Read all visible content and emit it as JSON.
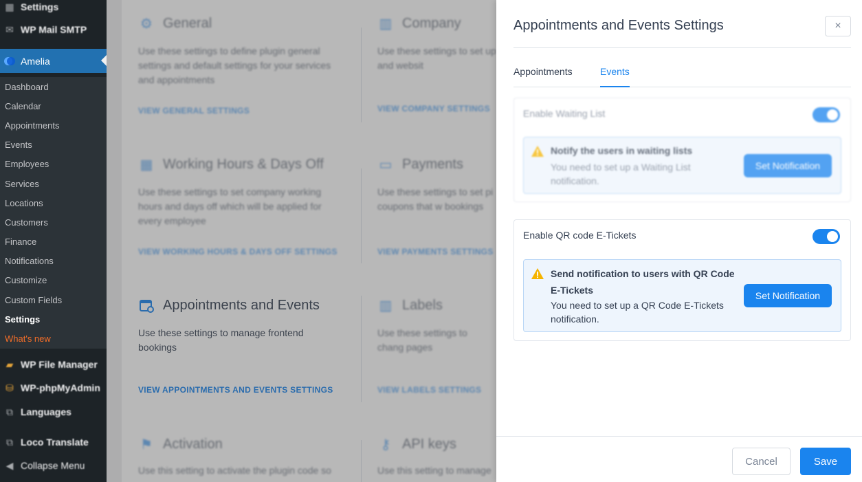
{
  "wp_menu": {
    "top_items": [
      {
        "label": "Settings",
        "icon": "settings-icon"
      },
      {
        "label": "WP Mail SMTP",
        "icon": "mail-icon"
      }
    ],
    "amelia": {
      "label": "Amelia",
      "icon": "amelia-logo-icon"
    },
    "submenu": [
      "Dashboard",
      "Calendar",
      "Appointments",
      "Events",
      "Employees",
      "Services",
      "Locations",
      "Customers",
      "Finance",
      "Notifications",
      "Customize",
      "Custom Fields",
      "Settings",
      "What's new"
    ],
    "bottom_items": [
      {
        "label": "WP File Manager",
        "icon": "folder-icon"
      },
      {
        "label": "WP-phpMyAdmin",
        "icon": "database-icon"
      },
      {
        "label": "Languages",
        "icon": "translate-icon"
      },
      {
        "label": "Loco Translate",
        "icon": "translate-icon"
      },
      {
        "label": "Collapse Menu",
        "icon": "collapse-icon"
      }
    ]
  },
  "settings_cards": [
    {
      "title": "General",
      "desc": "Use these settings to define plugin general settings and default settings for your services and appointments",
      "link": "VIEW GENERAL SETTINGS",
      "icon": "gear-icon"
    },
    {
      "title": "Company",
      "desc": "Use these settings to set up address, phone and websit",
      "link": "VIEW COMPANY SETTINGS",
      "icon": "building-icon"
    },
    {
      "title": "Working Hours & Days Off",
      "desc": "Use these settings to set company working hours and days off which will be applied for every employee",
      "link": "VIEW WORKING HOURS & DAYS OFF SETTINGS",
      "icon": "calendar-icon"
    },
    {
      "title": "Payments",
      "desc": "Use these settings to set pi method and coupons that w bookings",
      "link": "VIEW PAYMENTS SETTINGS",
      "icon": "credit-card-icon"
    },
    {
      "title": "Appointments and Events",
      "desc": "Use these settings to manage frontend bookings",
      "link": "VIEW APPOINTMENTS AND EVENTS SETTINGS",
      "icon": "calendar-gear-icon"
    },
    {
      "title": "Labels",
      "desc": "Use these settings to chang pages",
      "link": "VIEW LABELS SETTINGS",
      "icon": "books-icon"
    },
    {
      "title": "Activation",
      "desc": "Use this setting to activate the plugin code so",
      "link": "",
      "icon": "activation-icon"
    },
    {
      "title": "API keys",
      "desc": "Use this setting to manage",
      "link": "",
      "icon": "key-icon"
    }
  ],
  "dialog": {
    "title": "Appointments and Events Settings",
    "close_label": "×",
    "tabs": [
      {
        "label": "Appointments"
      },
      {
        "label": "Events"
      }
    ],
    "waiting_list": {
      "label": "Enable Waiting List",
      "enabled": true,
      "alert_title": "Notify the users in waiting lists",
      "alert_desc": "You need to set up a Waiting List notification.",
      "button": "Set Notification"
    },
    "qr_tickets": {
      "label": "Enable QR code E-Tickets",
      "enabled": true,
      "alert_title": "Send notification to users with QR Code E-Tickets",
      "alert_desc": "You need to set up a QR Code E-Tickets notification.",
      "button": "Set Notification"
    },
    "cancel_label": "Cancel",
    "save_label": "Save"
  },
  "colors": {
    "accent": "#1a84ee",
    "wp_sidebar": "#1d2327",
    "wp_active": "#2271b1",
    "whats_new": "#f56e28",
    "warning": "#f5b400"
  }
}
